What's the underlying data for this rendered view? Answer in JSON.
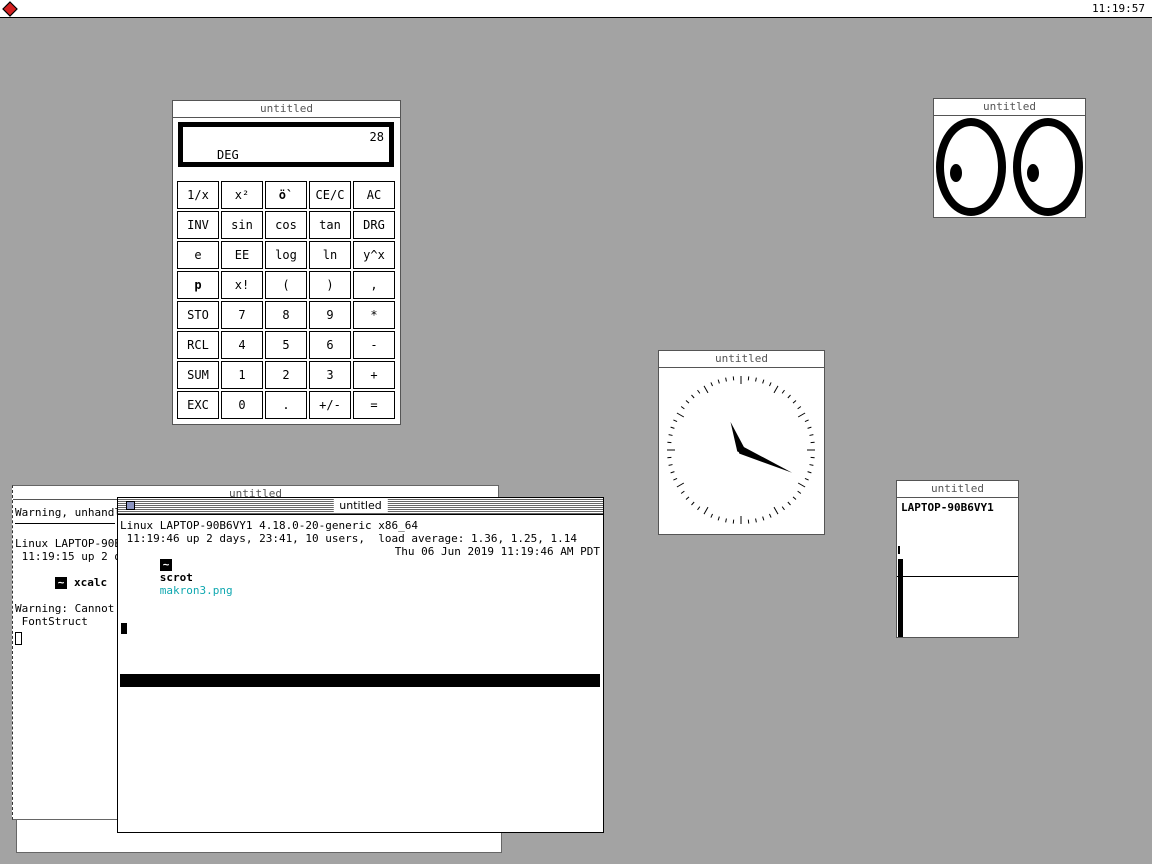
{
  "menubar": {
    "clock": "11:19:57",
    "logo_color": "#d42020"
  },
  "calculator": {
    "title": "untitled",
    "display_value": "28",
    "display_mode": "DEG",
    "keys": [
      "1/x",
      "x²",
      "ö`",
      "CE/C",
      "AC",
      "INV",
      "sin",
      "cos",
      "tan",
      "DRG",
      "e",
      "EE",
      "log",
      "ln",
      "y^x",
      "p",
      "x!",
      "(",
      ")",
      ",",
      "STO",
      "7",
      "8",
      "9",
      "*",
      "RCL",
      "4",
      "5",
      "6",
      "-",
      "SUM",
      "1",
      "2",
      "3",
      "+",
      "EXC",
      "0",
      ".",
      "+/-",
      "="
    ]
  },
  "xeyes": {
    "title": "untitled"
  },
  "xclock": {
    "title": "untitled",
    "time": "11:19"
  },
  "xload": {
    "title": "untitled",
    "hostname": "LAPTOP-90B6VY1"
  },
  "back_terminal": {
    "title": "untitled",
    "line1": "Warning, unhandled",
    "line2": "Linux LAPTOP-90B6",
    "line3": " 11:19:15 up 2 da",
    "prompt": "~",
    "command": "xcalc",
    "line4": "Warning: Cannot c",
    "line5": " FontStruct"
  },
  "front_terminal": {
    "title": "untitled",
    "uname_line": "Linux LAPTOP-90B6VY1 4.18.0-20-generic x86_64",
    "uptime_line": " 11:19:46 up 2 days, 23:41, 10 users,  load average: 1.36, 1.25, 1.14",
    "prompt": "~",
    "command": "scrot",
    "argument": "makron3.png",
    "datetime": "Thu 06 Jun 2019 11:19:46 AM PDT"
  }
}
